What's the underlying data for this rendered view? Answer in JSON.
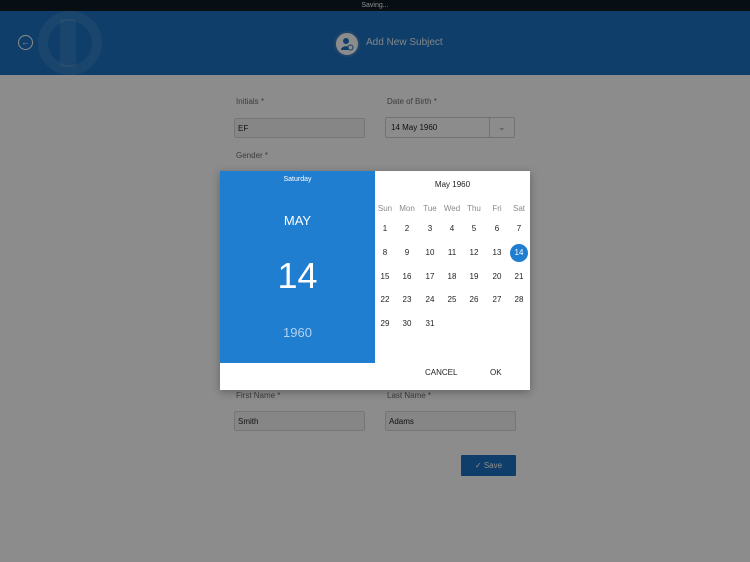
{
  "status_bar": {
    "text": "Saving..."
  },
  "header": {
    "title": "Add New Subject"
  },
  "form": {
    "initials_label": "Initials",
    "initials_value": "EF",
    "dob_label": "Date of Birth",
    "dob_value": "14 May 1960",
    "gender_label": "Gender",
    "first_name_label": "First Name",
    "first_name_value": "Smith",
    "last_name_label": "Last Name",
    "last_name_value": "Adams",
    "required_mark": "*",
    "save_label": "Save"
  },
  "datepicker": {
    "day_of_week": "Saturday",
    "month": "MAY",
    "day": "14",
    "year": "1960",
    "calendar_title": "May 1960",
    "weekdays": [
      "Sun",
      "Mon",
      "Tue",
      "Wed",
      "Thu",
      "Fri",
      "Sat"
    ],
    "days": [
      [
        "1",
        "2",
        "3",
        "4",
        "5",
        "6",
        "7"
      ],
      [
        "8",
        "9",
        "10",
        "11",
        "12",
        "13",
        "14"
      ],
      [
        "15",
        "16",
        "17",
        "18",
        "19",
        "20",
        "21"
      ],
      [
        "22",
        "23",
        "24",
        "25",
        "26",
        "27",
        "28"
      ],
      [
        "29",
        "30",
        "31"
      ]
    ],
    "selected_day": "14",
    "cancel_label": "CANCEL",
    "ok_label": "OK"
  },
  "colors": {
    "primary": "#1a72c0",
    "picker_header": "#1f7ecf"
  }
}
